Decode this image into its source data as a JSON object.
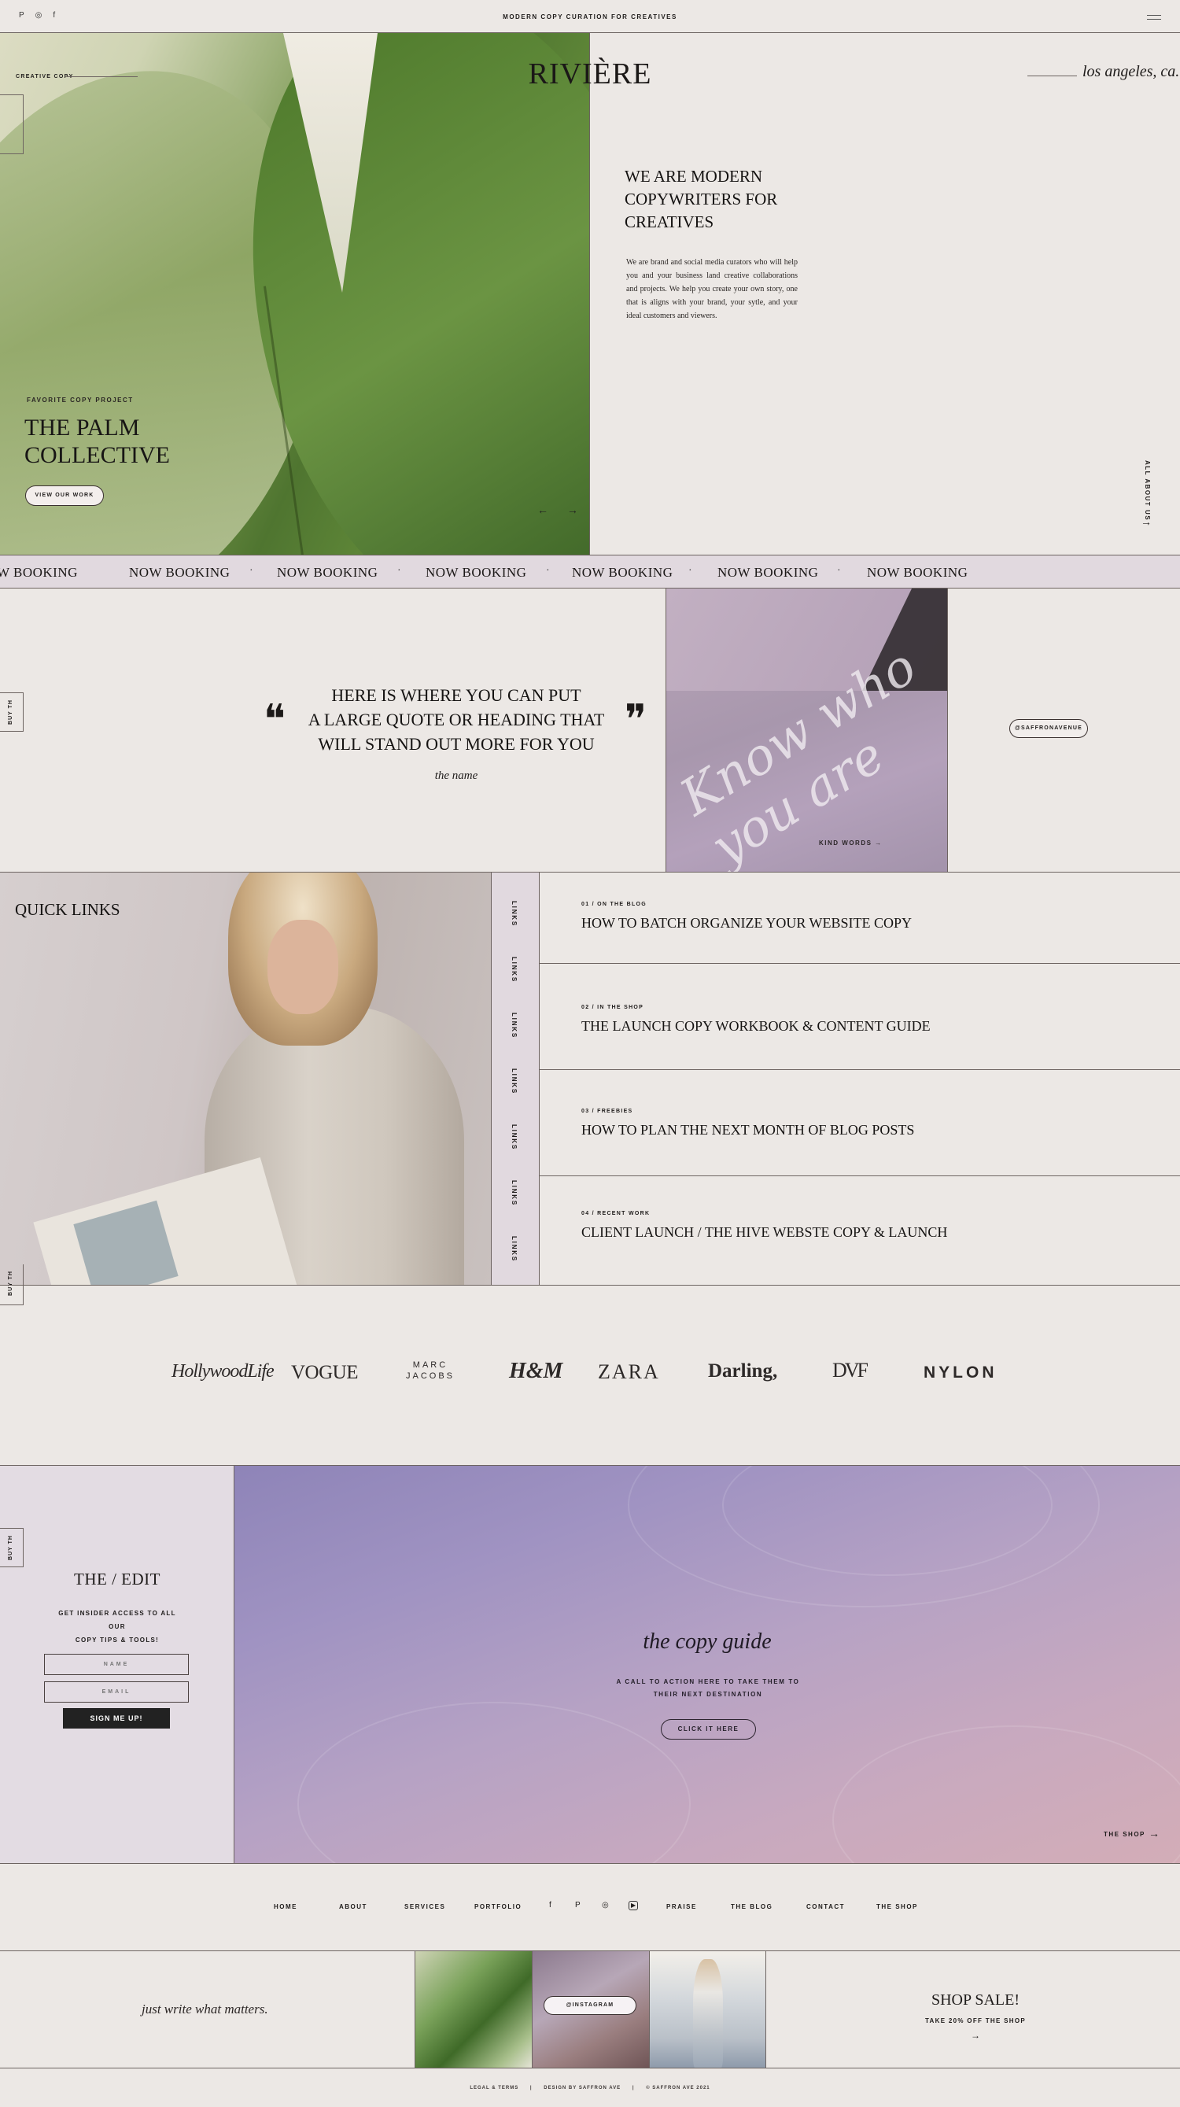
{
  "topbar": {
    "social": [
      "P",
      "◎",
      "f"
    ],
    "tagline": "MODERN COPY CURATION FOR CREATIVES"
  },
  "brand": {
    "name": "RIVIÈRE",
    "creative_label": "CREATIVE COPY",
    "location": "los angeles, ca."
  },
  "hero": {
    "kicker": "FAVORITE COPY PROJECT",
    "title_line1": "THE PALM",
    "title_line2": "COLLECTIVE",
    "button": "VIEW OUR WORK",
    "arrows": "← →"
  },
  "about": {
    "title_line1": "WE ARE MODERN",
    "title_line2": "COPYWRITERS FOR",
    "title_line3": "CREATIVES",
    "body": "We are brand and social media curators who will help you and your business land creative collaborations and projects. We help you create your own story, one that is aligns with your brand, your sytle, and your ideal customers and viewers.",
    "side_link": "ALL ABOUT US",
    "side_arrow": "→"
  },
  "marquee": {
    "items": [
      "W BOOKING",
      "NOW BOOKING",
      "NOW BOOKING",
      "NOW BOOKING",
      "NOW BOOKING",
      "NOW BOOKING",
      "NOW BOOKING"
    ],
    "sep": "·"
  },
  "quote": {
    "open": "❝",
    "close": "❞",
    "line1": "HERE IS WHERE YOU CAN PUT",
    "line2": "A LARGE QUOTE OR HEADING THAT",
    "line3": "WILL STAND OUT MORE FOR YOU",
    "name": "the name",
    "side_tab": "BUY TH",
    "kind_words": "KIND WORDS  →",
    "handle_button": "@SAFFRONAVENUE"
  },
  "quick_links": {
    "title": "QUICK LINKS",
    "strip_label": "LINKS",
    "side_tab": "BUY TH",
    "rows": [
      {
        "meta": "01  /  ON THE BLOG",
        "head": "HOW TO BATCH ORGANIZE YOUR WEBSITE COPY"
      },
      {
        "meta": "02  /  IN THE SHOP",
        "head": "THE LAUNCH COPY WORKBOOK & CONTENT GUIDE"
      },
      {
        "meta": "03  /  FREEBIES",
        "head": "HOW TO PLAN THE NEXT MONTH OF BLOG POSTS"
      },
      {
        "meta": "04  /  RECENT WORK",
        "head": "CLIENT LAUNCH / THE HIVE WEBSTE COPY & LAUNCH"
      }
    ]
  },
  "logos": {
    "hollywood": "HollywoodLife",
    "vogue": "VOGUE",
    "marc1": "MARC",
    "marc2": "JACOBS",
    "hm": "H&M",
    "zara": "ZARA",
    "darling": "Darling,",
    "dvf": "DVF",
    "nylon": "NYLON"
  },
  "newsletter": {
    "side_tab": "BUY TH",
    "title": "THE / EDIT",
    "sub_line1": "GET INSIDER ACCESS TO ALL OUR",
    "sub_line2": "COPY TIPS & TOOLS!",
    "name_placeholder": "NAME",
    "email_placeholder": "EMAIL",
    "submit": "SIGN ME UP!"
  },
  "copy_guide": {
    "title": "the copy guide",
    "sub_line1": "A CALL TO ACTION HERE TO TAKE THEM TO",
    "sub_line2": "THEIR NEXT DESTINATION",
    "button": "CLICK IT HERE",
    "shop_link": "THE SHOP",
    "shop_arrow": "→"
  },
  "footer_nav": {
    "home": "HOME",
    "about": "ABOUT",
    "services": "SERVICES",
    "portfolio": "PORTFOLIO",
    "icon_facebook": "f",
    "icon_pinterest": "P",
    "icon_instagram": "◎",
    "icon_youtube": "▶",
    "praise": "PRAISE",
    "blog": "THE BLOG",
    "contact": "CONTACT",
    "shop": "THE SHOP"
  },
  "instagram": {
    "script": "just write what matters.",
    "button": "@INSTAGRAM"
  },
  "sale": {
    "title": "SHOP SALE!",
    "sub": "TAKE 20% OFF THE SHOP",
    "arrow": "→"
  },
  "legal": {
    "terms": "LEGAL & TERMS",
    "design": "DESIGN BY SAFFRON AVE",
    "copyright": "© SAFFRON AVE 2021",
    "sep": "|"
  }
}
